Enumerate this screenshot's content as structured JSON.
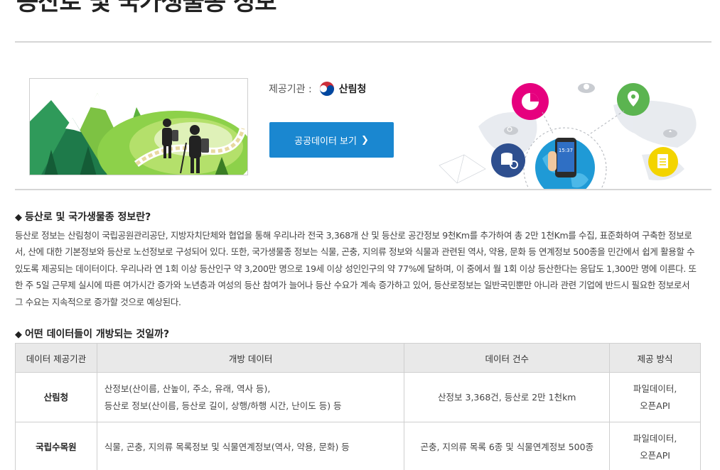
{
  "page": {
    "title": "등산로 및 국가생물종 정보"
  },
  "hero": {
    "provider_label": "제공기관 :",
    "provider_name": "산림청",
    "view_button_label": "공공데이터 보기",
    "view_button_chevron": "❯",
    "phone_time": "15:37",
    "colors": {
      "button": "#1a87d0",
      "pie": "#e6007e",
      "location": "#5bb450",
      "database": "#2e4f8f",
      "document": "#f3d400",
      "globe": "#1f9ad6"
    }
  },
  "about": {
    "heading": "등산로 및 국가생물종 정보란?",
    "paragraph": " 등산로 정보는 산림청이 국립공원관리공단, 지방자치단체와 협업을 통해 우리나라 전국 3,368개 산 및 등산로 공간정보 9천Km를 추가하여 총 2만 1천Km를 수집, 표준화하여 구축한 정보로서, 산에 대한 기본정보와 등산로 노선정보로 구성되어 있다. 또한, 국가생물종 정보는 식물, 곤충, 지의류 정보와 식물과 관련된 역사, 약용, 문화 등 연계정보 500종을 민간에서 쉽게 활용할 수 있도록 제공되는 데이터이다. 우리나라 연 1회 이상 등산인구 약 3,200만 명으로 19세 이상 성인인구의 약 77%에 달하며, 이 중에서 월 1회 이상 등산한다는 응답도 1,300만 명에 이른다. 또한 주 5일 근무제 실시에 따른 여가시간 증가와 노년층과 여성의 등산 참여가 늘어나 등산 수요가 계속 증가하고 있어, 등산로정보는 일반국민뿐만 아니라 관련 기업에 반드시 필요한 정보로서 그 수요는 지속적으로 증가할 것으로 예상된다."
  },
  "open_data": {
    "heading": "어떤 데이터들이 개방되는 것일까?",
    "diamond": "◆",
    "columns": [
      "데이터 제공기관",
      "개방 데이터",
      "데이터 건수",
      "제공 방식"
    ],
    "rows": [
      {
        "org": "산림청",
        "data_line1": "산정보(산이름, 산높이, 주소, 유래, 역사 등),",
        "data_line2": "등산로 정보(산이름, 등산로 길이, 상행/하행 시간, 난이도 등) 등",
        "count": "산정보 3,368건, 등산로 2만 1천km",
        "method_line1": "파일데이터,",
        "method_line2": "오픈API"
      },
      {
        "org": "국립수목원",
        "data_line1": "식물, 곤충, 지의류 목록정보 및 식물연계정보(역사, 약용, 문화) 등",
        "count": "곤충, 지의류 목록 6종 및 식물연계정보 500종",
        "method_line1": "파일데이터,",
        "method_line2": "오픈API"
      }
    ]
  }
}
